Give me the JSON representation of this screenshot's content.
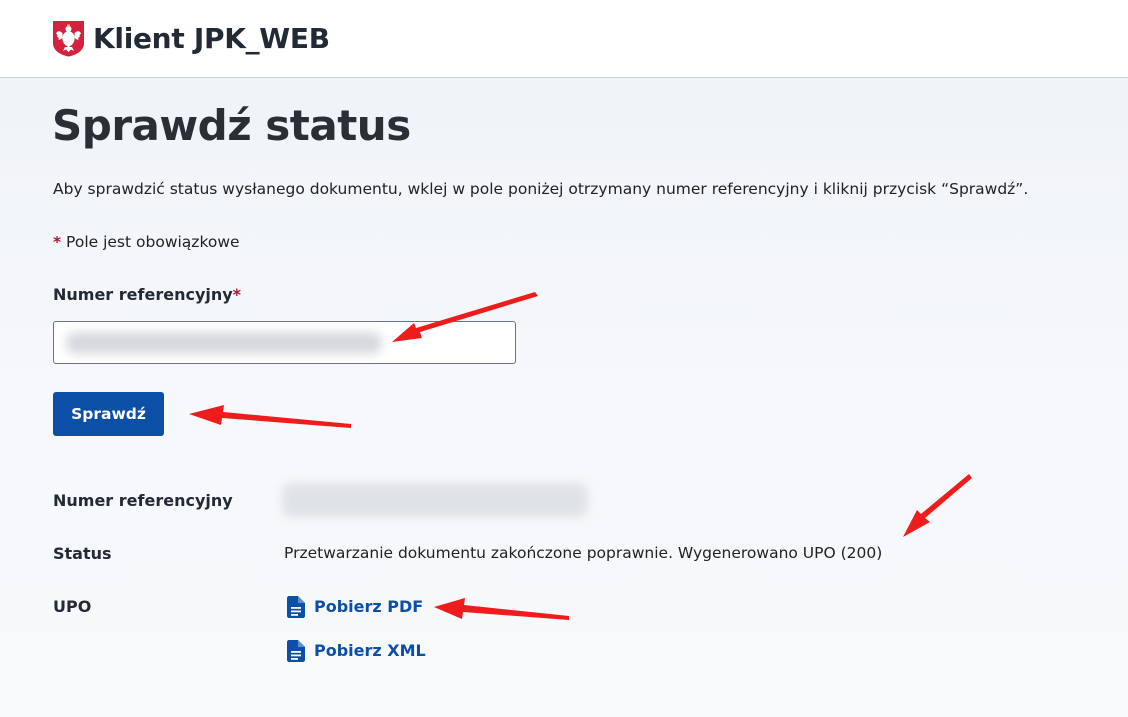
{
  "header": {
    "app_title": "Klient JPK_WEB",
    "logo_icon": "polish-eagle-emblem-icon"
  },
  "main": {
    "title": "Sprawdź status",
    "intro": "Aby sprawdzić status wysłanego dokumentu, wklej w pole poniżej otrzymany numer referencyjny i kliknij przycisk “Sprawdź”.",
    "required_star": "*",
    "required_note": "Pole jest obowiązkowe",
    "form": {
      "label": "Numer referencyjny",
      "label_star": "*",
      "input_value": "",
      "button_label": "Sprawdź"
    },
    "result": {
      "ref_label": "Numer referencyjny",
      "status_label": "Status",
      "status_value": "Przetwarzanie dokumentu zakończone poprawnie. Wygenerowano UPO (200)",
      "upo_label": "UPO",
      "download_pdf": "Pobierz PDF",
      "download_xml": "Pobierz XML",
      "file_icon": "document-file-icon"
    }
  },
  "colors": {
    "primary": "#0b4fa6",
    "required": "#b0142d",
    "annotation_arrow": "#ee1c1c",
    "emblem_red": "#d4213d"
  }
}
